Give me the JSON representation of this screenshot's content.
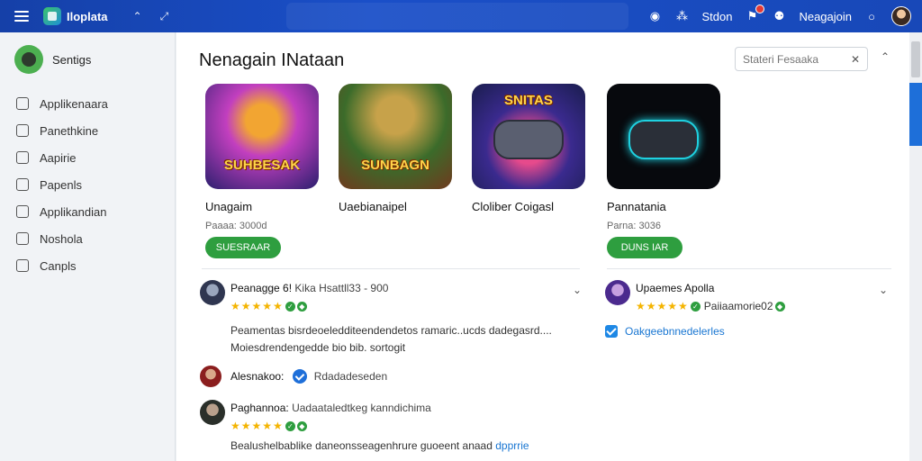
{
  "topbar": {
    "brand": "Iloplata",
    "right_user": "Neagajoin",
    "right_text": "Stdon",
    "icons": [
      "menu-icon",
      "logo-icon",
      "chevron-up-icon",
      "expand-icon",
      "chat-icon",
      "settings-icon",
      "notification-icon",
      "user-icon",
      "help-icon",
      "avatar"
    ]
  },
  "sidebar": {
    "profile_name": "Sentigs",
    "items": [
      {
        "label": "Applikenaara",
        "icon": "apps-icon"
      },
      {
        "label": "Panethkine",
        "icon": "list-icon"
      },
      {
        "label": "Aapirie",
        "icon": "inbox-icon"
      },
      {
        "label": "Papenls",
        "icon": "doc-icon"
      },
      {
        "label": "Applikandian",
        "icon": "grid-icon"
      },
      {
        "label": "Noshola",
        "icon": "share-icon"
      },
      {
        "label": "Canpls",
        "icon": "folder-icon"
      }
    ]
  },
  "main": {
    "title": "Nenagain INataan",
    "search_placeholder": "Stateri Fesaaka",
    "cards": [
      {
        "name": "Unagaim",
        "price": "Paaaa: 3000d",
        "button": "SUESRAAR",
        "art_text": "SUHBESAK",
        "colors": [
          "#2b1f6e",
          "#c23fbf",
          "#f2a532"
        ]
      },
      {
        "name": "Uaebianaipel",
        "price": "",
        "button": "",
        "art_text": "SUNBAGN",
        "colors": [
          "#3b6b2a",
          "#c7a24a",
          "#6f3a1e"
        ]
      },
      {
        "name": "Cloliber Coigasl",
        "price": "",
        "button": "",
        "art_text": "SNITAS",
        "colors": [
          "#1a1d4e",
          "#e64a8c",
          "#f5b638"
        ]
      },
      {
        "name": "Pannatania",
        "price": "Parna: 3036",
        "button": "DUNS IAR",
        "art_text": "",
        "colors": [
          "#07090d",
          "#1fd1e0",
          "#2a2f38"
        ]
      }
    ],
    "reviews_left": [
      {
        "name": "Peanagge 6!",
        "meta": "Kika Hsattll33 - 900",
        "stars": "★★★★★",
        "body1": "Peamentas bisrdeoeledditeendendetos ramaric..ucds dadegasrd....",
        "body2": "Moiesdrendengedde bio bib. sortogit"
      },
      {
        "name": "Alesnakoo:",
        "link": "Rdadadeseden"
      },
      {
        "name": "Paghannoa:",
        "meta": "Uadaataledtkeg kanndichima",
        "stars": "★★★★★",
        "body": "Bealushelbablike daneonsseagenhrure guoeent anaad",
        "body_link": "dpprrie"
      }
    ],
    "reviews_right": [
      {
        "name": "Upaemes Apolla",
        "stars": "★★★★★",
        "meta": "Paiiaamorie02",
        "link": "Oakgeebnnedelerles"
      }
    ]
  }
}
